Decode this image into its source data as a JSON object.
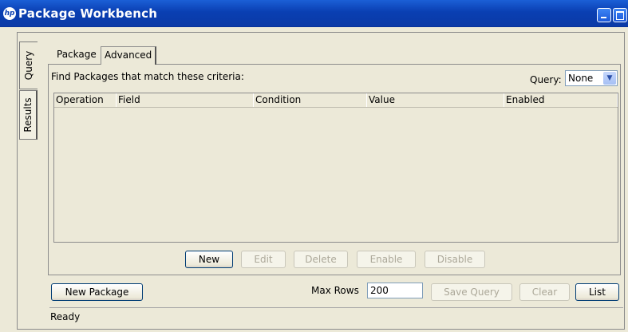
{
  "window": {
    "title": "Package Workbench",
    "logo_text": "hp"
  },
  "side_tabs": [
    {
      "label": "Query"
    },
    {
      "label": "Results"
    }
  ],
  "tabs": [
    {
      "label": "Package"
    },
    {
      "label": "Advanced"
    }
  ],
  "criteria_label": "Find Packages that match these criteria:",
  "query": {
    "label": "Query:",
    "value": "None"
  },
  "table": {
    "columns": [
      "Operation",
      "Field",
      "Condition",
      "Value",
      "Enabled"
    ],
    "rows": []
  },
  "table_buttons": {
    "new": "New",
    "edit": "Edit",
    "delete": "Delete",
    "enable": "Enable",
    "disable": "Disable"
  },
  "bottom": {
    "new_package": "New Package",
    "max_rows_label": "Max Rows",
    "max_rows_value": "200",
    "save_query": "Save Query",
    "clear": "Clear",
    "list": "List"
  },
  "status": "Ready"
}
